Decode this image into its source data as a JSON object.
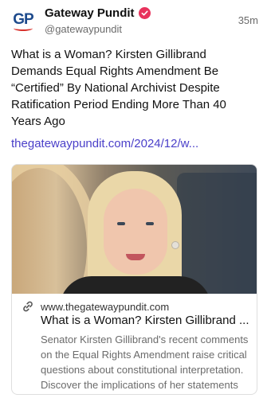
{
  "author": {
    "display_name": "Gateway Pundit",
    "handle": "@gatewaypundit",
    "avatar_text": "GP",
    "verified_icon": "verified-badge-icon",
    "verified_color": "#e8325c"
  },
  "timestamp": "35m",
  "post": {
    "text": "What is a Woman? Kirsten Gillibrand Demands Equal Rights Amendment Be “Certified” By National Archivist Despite Ratification Period Ending More Than 40 Years Ago",
    "link": "thegatewaypundit.com/2024/12/w..."
  },
  "link_card": {
    "domain": "www.thegatewaypundit.com",
    "title": "What is a Woman? Kirsten Gillibrand ...",
    "description": "Senator Kirsten Gillibrand's recent comments on the Equal Rights Amendment raise critical questions about constitutional interpretation. Discover the implications of her statements ...",
    "icon": "link-icon"
  },
  "colors": {
    "link": "#4a3fc9",
    "muted": "#6b6b6b"
  }
}
